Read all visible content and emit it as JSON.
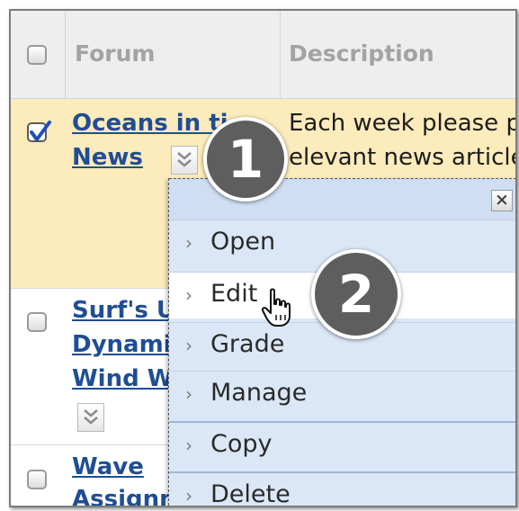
{
  "table": {
    "headers": {
      "forum": "Forum",
      "description": "Description"
    },
    "rows": [
      {
        "title_lines": [
          "Oceans in ti",
          "News"
        ],
        "description_lines": [
          "Each week please po",
          "elevant news article"
        ],
        "checked": true
      },
      {
        "title_lines": [
          "Surf's U",
          "Dynamic",
          "Wind Wa"
        ],
        "checked": false
      },
      {
        "title_lines": [
          "Wave",
          "Assignm"
        ],
        "checked": false
      }
    ]
  },
  "context_menu": {
    "close_label": "×",
    "items": [
      {
        "label": "Open"
      },
      {
        "label": "Edit"
      },
      {
        "label": "Grade"
      },
      {
        "label": "Manage"
      },
      {
        "label": "Copy"
      },
      {
        "label": "Delete"
      }
    ],
    "item_arrow": "›"
  },
  "steps": {
    "one": "1",
    "two": "2"
  },
  "colors": {
    "selected_row": "#fcebbb",
    "link": "#1f4e94",
    "menu_bg": "#dbe7f6",
    "badge": "#5e5e5e"
  }
}
